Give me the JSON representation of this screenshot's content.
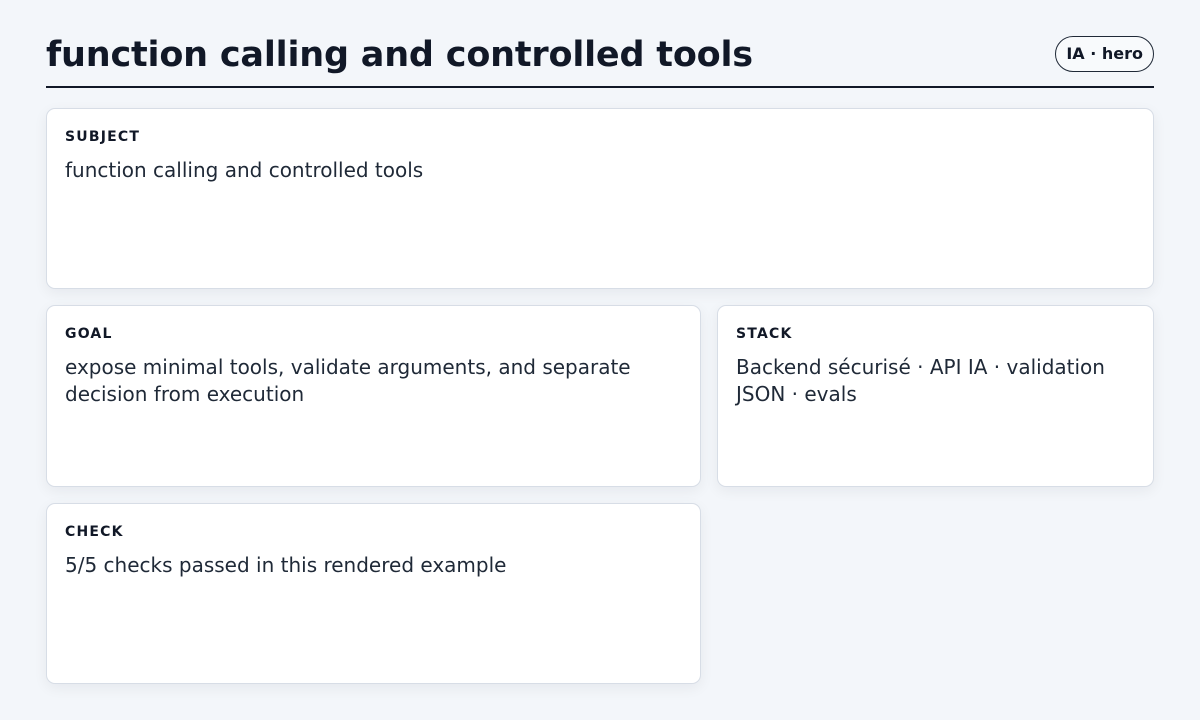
{
  "header": {
    "title": "function calling and controlled tools",
    "badge": "IA · hero"
  },
  "cards": {
    "subject": {
      "label": "SUBJECT",
      "text": "function calling and controlled tools"
    },
    "goal": {
      "label": "GOAL",
      "text": "expose minimal tools, validate arguments, and separate decision from execution"
    },
    "stack": {
      "label": "STACK",
      "text": "Backend sécurisé · API IA · validation JSON · evals"
    },
    "check": {
      "label": "CHECK",
      "text": "5/5 checks passed in this rendered example"
    }
  }
}
